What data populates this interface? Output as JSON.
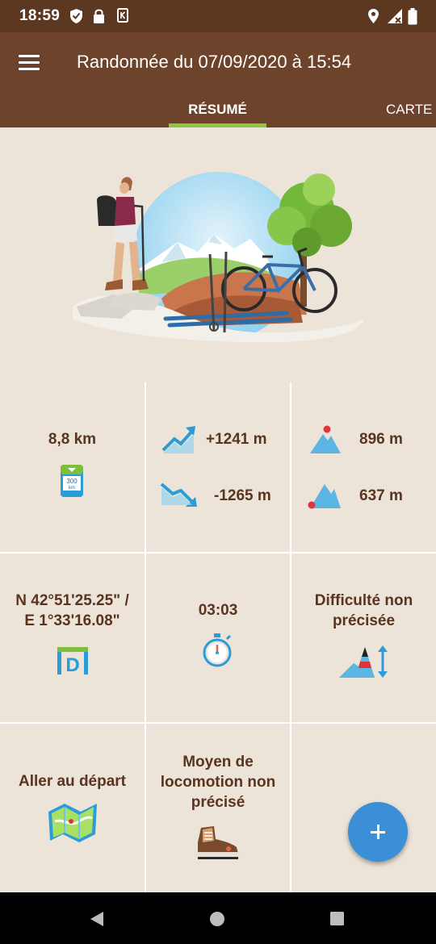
{
  "status_bar": {
    "time": "18:59",
    "left_icons": [
      "shield-icon",
      "lock-icon",
      "k-notification-icon"
    ],
    "right_icons": [
      "location-icon",
      "signal-icon",
      "battery-icon"
    ]
  },
  "app_bar": {
    "title": "Randonnée du 07/09/2020 à 15:54",
    "menu_icon": "hamburger-menu-icon",
    "tabs": [
      {
        "label": "RÉSUMÉ",
        "active": true
      },
      {
        "label": "CARTE",
        "active": false
      }
    ],
    "colors": {
      "bar": "#6d432c",
      "status": "#5d3820",
      "indicator": "#8cc63f"
    }
  },
  "hero": {
    "image": "hiker-bike-skis-illustration"
  },
  "stats": {
    "distance": "8,8 km",
    "elevation_gain": "+1241 m",
    "elevation_loss": "-1265 m",
    "altitude_max": "896 m",
    "altitude_min": "637 m",
    "coordinates_line1": "N 42°51'25.25\" /",
    "coordinates_line2": "E 1°33'16.08\"",
    "duration": "03:03",
    "difficulty_line1": "Difficulté non",
    "difficulty_line2": "précisée",
    "goto_start": "Aller au départ",
    "locomotion_line1": "Moyen de",
    "locomotion_line2": "locomotion non",
    "locomotion_line3": "précisé"
  },
  "fab": {
    "icon": "plus-icon",
    "color": "#3b8fd6"
  },
  "nav_bar": {
    "icons": [
      "back-icon",
      "home-icon",
      "recents-icon"
    ]
  },
  "colors": {
    "background": "#ece4d8",
    "text": "#5b3420",
    "accent_blue": "#3b8fd6"
  }
}
